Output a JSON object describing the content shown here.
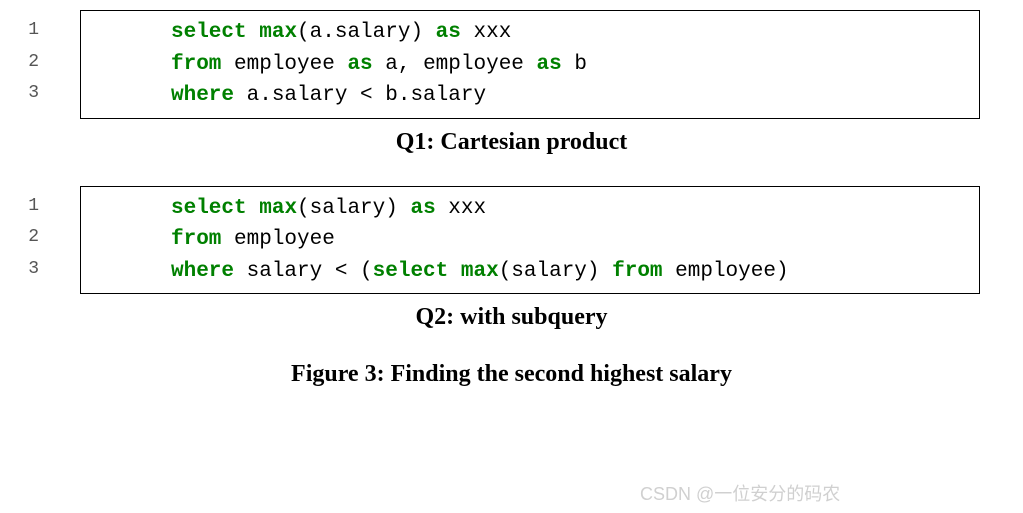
{
  "q1": {
    "lines": [
      {
        "num": "1",
        "pre": "",
        "k1": "select",
        "mid1": " ",
        "k2": "max",
        "mid2": "(a.salary) ",
        "k3": "as",
        "mid3": " xxx",
        "k4": "",
        "mid4": "",
        "k5": "",
        "mid5": ""
      },
      {
        "num": "2",
        "pre": "",
        "k1": "from",
        "mid1": " employee ",
        "k2": "as",
        "mid2": " a, employee ",
        "k3": "as",
        "mid3": " b",
        "k4": "",
        "mid4": "",
        "k5": "",
        "mid5": ""
      },
      {
        "num": "3",
        "pre": "",
        "k1": "where",
        "mid1": " a.salary < b.salary",
        "k2": "",
        "mid2": "",
        "k3": "",
        "mid3": "",
        "k4": "",
        "mid4": "",
        "k5": "",
        "mid5": ""
      }
    ],
    "caption": "Q1: Cartesian product"
  },
  "q2": {
    "lines": [
      {
        "num": "1",
        "pre": "",
        "k1": "select",
        "mid1": " ",
        "k2": "max",
        "mid2": "(salary) ",
        "k3": "as",
        "mid3": " xxx",
        "k4": "",
        "mid4": "",
        "k5": "",
        "mid5": ""
      },
      {
        "num": "2",
        "pre": "",
        "k1": "from",
        "mid1": " employee",
        "k2": "",
        "mid2": "",
        "k3": "",
        "mid3": "",
        "k4": "",
        "mid4": "",
        "k5": "",
        "mid5": ""
      },
      {
        "num": "3",
        "pre": "",
        "k1": "where",
        "mid1": " salary < (",
        "k2": "select",
        "mid2": " ",
        "k3": "max",
        "mid3": "(salary) ",
        "k4": "from",
        "mid4": " employee)",
        "k5": "",
        "mid5": ""
      }
    ],
    "caption": "Q2: with subquery"
  },
  "figure_caption": "Figure 3: Finding the second highest salary",
  "watermark": "CSDN @一位安分的码农"
}
